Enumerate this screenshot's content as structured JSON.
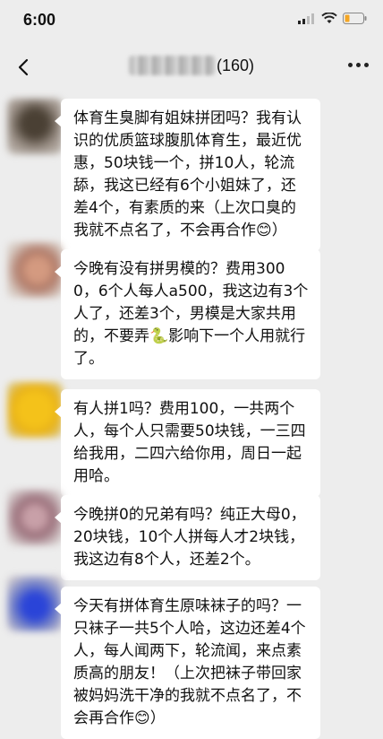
{
  "status": {
    "time": "6:00"
  },
  "header": {
    "member_count": "(160)"
  },
  "messages": [
    {
      "text": "体育生臭脚有姐妹拼团吗？我有认识的优质篮球腹肌体育生，最近优惠，50块钱一个，拼10人，轮流舔，我这已经有6个小姐妹了，还差4个，有素质的来（上次口臭的我就不点名了，不会再合作😊）"
    },
    {
      "text": "今晚有没有拼男模的？费用3000，6个人每人a500，我这边有3个人了，还差3个，男模是大家共用的，不要弄🐍影响下一个人用就行了。"
    },
    {
      "text": "有人拼1吗？费用100，一共两个人，每个人只需要50块钱，一三四给我用，二四六给你用，周日一起用哈。"
    },
    {
      "text": "今晚拼0的兄弟有吗？纯正大母0，20块钱，10个人拼每人才2块钱，我这边有8个人，还差2个。"
    },
    {
      "text": "今天有拼体育生原味袜子的吗？一只袜子一共5个人哈，这边还差4个人，每人闻两下，轮流闻，来点素质高的朋友！（上次把袜子带回家被妈妈洗干净的我就不点名了，不会再合作😊）"
    }
  ],
  "colors": {
    "background": "#ededed",
    "bubble": "#ffffff"
  },
  "icons": [
    "back-icon",
    "more-icon",
    "signal-icon",
    "wifi-icon",
    "battery-icon"
  ]
}
